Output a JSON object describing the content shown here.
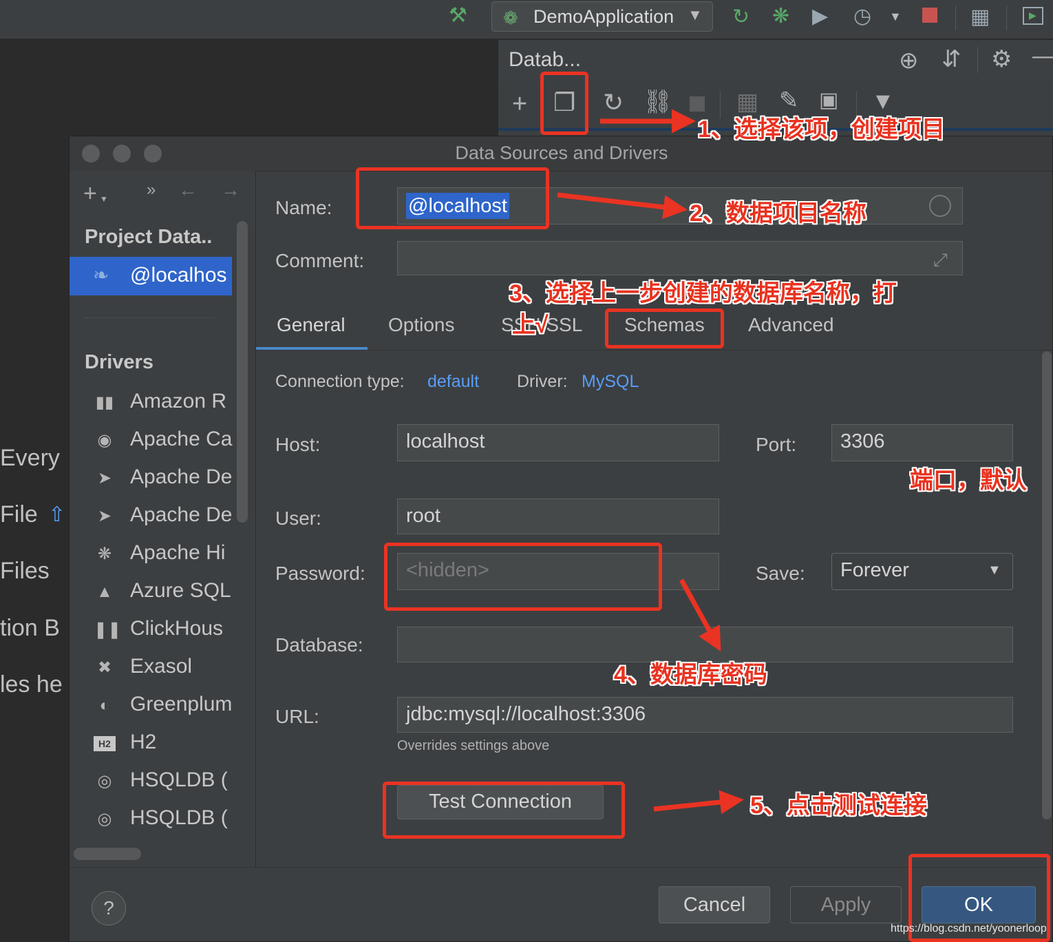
{
  "toolbar": {
    "run_config": "DemoApplication"
  },
  "db_panel": {
    "title": "Datab..."
  },
  "background_text": [
    "Every",
    "File",
    "Files",
    "tion B",
    "les he"
  ],
  "dialog": {
    "title": "Data Sources and Drivers",
    "sidebar": {
      "project_section": "Project Data..",
      "selected_item": "@localhos",
      "drivers_section": "Drivers",
      "drivers": [
        {
          "label": "Amazon R",
          "icon": "amazon-redshift-icon"
        },
        {
          "label": "Apache Ca",
          "icon": "apache-cassandra-icon"
        },
        {
          "label": "Apache De",
          "icon": "apache-derby-icon"
        },
        {
          "label": "Apache De",
          "icon": "apache-derby-icon"
        },
        {
          "label": "Apache Hi",
          "icon": "apache-hive-icon"
        },
        {
          "label": "Azure SQL",
          "icon": "azure-sql-icon"
        },
        {
          "label": "ClickHous",
          "icon": "clickhouse-icon"
        },
        {
          "label": "Exasol",
          "icon": "exasol-icon"
        },
        {
          "label": "Greenplum",
          "icon": "greenplum-icon"
        },
        {
          "label": "H2",
          "icon": "h2-icon"
        },
        {
          "label": "HSQLDB (",
          "icon": "hsqldb-icon"
        },
        {
          "label": "HSQLDB (",
          "icon": "hsqldb-icon"
        }
      ]
    },
    "form": {
      "name_label": "Name:",
      "name_value": "@localhost",
      "comment_label": "Comment:",
      "comment_value": "",
      "tabs": [
        "General",
        "Options",
        "SSH/SSL",
        "Schemas",
        "Advanced"
      ],
      "active_tab": "General",
      "connection_type_label": "Connection type:",
      "connection_type_value": "default",
      "driver_label": "Driver:",
      "driver_value": "MySQL",
      "host_label": "Host:",
      "host_value": "localhost",
      "port_label": "Port:",
      "port_value": "3306",
      "user_label": "User:",
      "user_value": "root",
      "password_label": "Password:",
      "password_placeholder": "<hidden>",
      "save_label": "Save:",
      "save_value": "Forever",
      "database_label": "Database:",
      "database_value": "",
      "url_label": "URL:",
      "url_value": "jdbc:mysql://localhost:3306",
      "url_hint": "Overrides settings above",
      "test_connection": "Test Connection"
    },
    "footer": {
      "help": "?",
      "cancel": "Cancel",
      "apply": "Apply",
      "ok": "OK"
    }
  },
  "annotations": {
    "step1": "1、选择该项，创建项目",
    "step2": "2、数据项目名称",
    "step3_line1": "3、选择上一步创建的数据库名称，打",
    "step3_line2": "上√",
    "port_note": "端口，默认",
    "step4": "4、数据库密码",
    "step5": "5、点击测试连接",
    "annotation_color": "#ea3323"
  },
  "watermark": "https://blog.csdn.net/yoonerloop"
}
